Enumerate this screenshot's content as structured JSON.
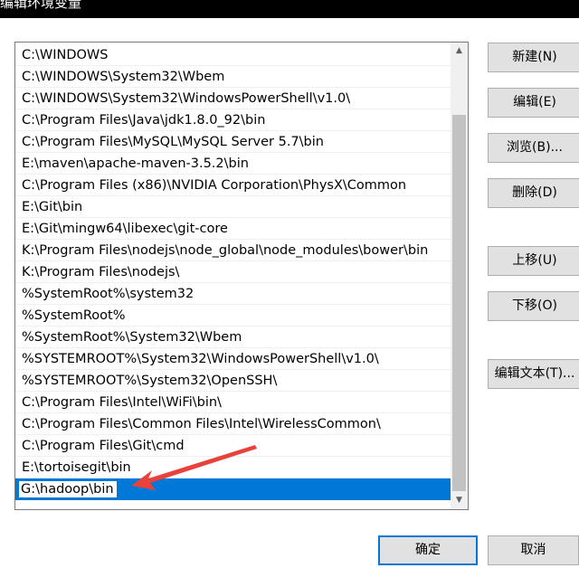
{
  "window": {
    "title": "编辑环境变量"
  },
  "paths": [
    "C:\\WINDOWS",
    "C:\\WINDOWS\\System32\\Wbem",
    "C:\\WINDOWS\\System32\\WindowsPowerShell\\v1.0\\",
    "C:\\Program Files\\Java\\jdk1.8.0_92\\bin",
    "C:\\Program Files\\MySQL\\MySQL Server 5.7\\bin",
    "E:\\maven\\apache-maven-3.5.2\\bin",
    "C:\\Program Files (x86)\\NVIDIA Corporation\\PhysX\\Common",
    "E:\\Git\\bin",
    "E:\\Git\\mingw64\\libexec\\git-core",
    "K:\\Program Files\\nodejs\\node_global\\node_modules\\bower\\bin",
    "K:\\Program Files\\nodejs\\",
    "%SystemRoot%\\system32",
    "%SystemRoot%",
    "%SystemRoot%\\System32\\Wbem",
    "%SYSTEMROOT%\\System32\\WindowsPowerShell\\v1.0\\",
    "%SYSTEMROOT%\\System32\\OpenSSH\\",
    "C:\\Program Files\\Intel\\WiFi\\bin\\",
    "C:\\Program Files\\Common Files\\Intel\\WirelessCommon\\",
    "C:\\Program Files\\Git\\cmd",
    "E:\\tortoisegit\\bin"
  ],
  "editing_value": "G:\\hadoop\\bin",
  "buttons": {
    "new": "新建(N)",
    "edit": "编辑(E)",
    "browse": "浏览(B)...",
    "delete": "删除(D)",
    "move_up": "上移(U)",
    "move_down": "下移(O)",
    "edit_text": "编辑文本(T)...",
    "ok": "确定",
    "cancel": "取消"
  },
  "colors": {
    "selection": "#0078d7",
    "annotation_arrow": "#e8423b"
  },
  "icons": {
    "scroll_up": "▲",
    "scroll_down": "▼"
  }
}
